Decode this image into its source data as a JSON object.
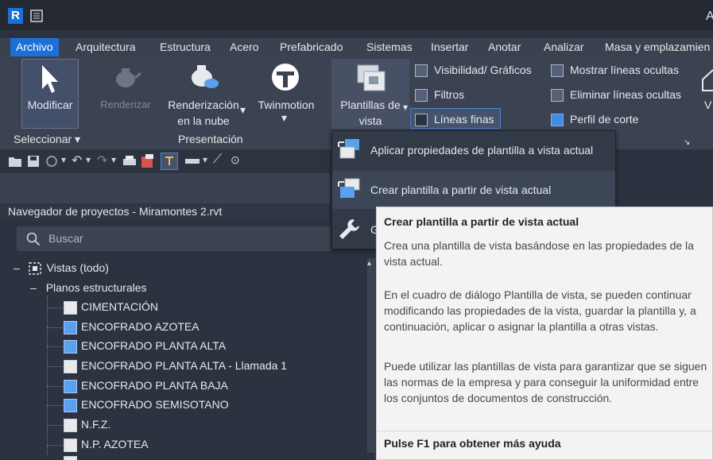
{
  "titlebar": {
    "logo": "R",
    "right_char": "A"
  },
  "tabs": [
    "Archivo",
    "Arquitectura",
    "Estructura",
    "Acero",
    "Prefabricado",
    "Sistemas",
    "Insertar",
    "Anotar",
    "Analizar",
    "Masa y emplazamien"
  ],
  "ribbon": {
    "modificar": "Modificar",
    "renderizar": "Renderizar",
    "renderizacion_nube_l1": "Renderización",
    "renderizacion_nube_l2": "en la nube",
    "twinmotion": "Twinmotion",
    "plantillas_l1": "Plantillas de",
    "plantillas_l2": "vista",
    "visibilidad": "Visibilidad/ Gráficos",
    "filtros": "Filtros",
    "lineas_finas": "Líneas finas",
    "mostrar_ocultas": "Mostrar líneas ocultas",
    "eliminar_ocultas": "Eliminar líneas ocultas",
    "perfil_corte": "Perfil de corte",
    "right_partial": "V",
    "seleccionar": "Seleccionar",
    "presentacion": "Presentación"
  },
  "navigator": {
    "title": "Navegador de proyectos - Miramontes 2.rvt",
    "search_placeholder": "Buscar",
    "root": "Vistas (todo)",
    "group": "Planos estructurales",
    "items": [
      {
        "label": "CIMENTACIÓN",
        "blue": false
      },
      {
        "label": "ENCOFRADO AZOTEA",
        "blue": true
      },
      {
        "label": "ENCOFRADO PLANTA ALTA",
        "blue": true
      },
      {
        "label": "ENCOFRADO PLANTA ALTA - Llamada 1",
        "blue": false
      },
      {
        "label": "ENCOFRADO PLANTA BAJA",
        "blue": true
      },
      {
        "label": "ENCOFRADO SEMISOTANO",
        "blue": true
      },
      {
        "label": "N.F.Z.",
        "blue": false
      },
      {
        "label": "N.P. AZOTEA",
        "blue": false
      }
    ]
  },
  "menu": {
    "aplicar": "Aplicar propiedades de plantilla a vista actual",
    "crear": "Crear plantilla a partir de vista actual",
    "gestionar_partial": "G"
  },
  "tooltip": {
    "title": "Crear plantilla a partir de vista actual",
    "p1": "Crea una plantilla de vista basándose en las propiedades de la vista actual.",
    "p2": "En el cuadro de diálogo Plantilla de vista, se pueden continuar modificando las propiedades de la vista, guardar la plantilla y, a continuación, aplicar o asignar la plantilla a otras vistas.",
    "p3": "Puede utilizar las plantillas de vista para garantizar que se siguen las normas de la empresa y para conseguir la uniformidad entre los conjuntos de documentos de construcción.",
    "footer": "Pulse F1 para obtener más ayuda"
  },
  "colors": {
    "accent": "#1d6fd8",
    "ribbon_bg": "#3b4352",
    "panel_bg": "#2c3340",
    "tooltip_bg": "#f3f3f4"
  }
}
